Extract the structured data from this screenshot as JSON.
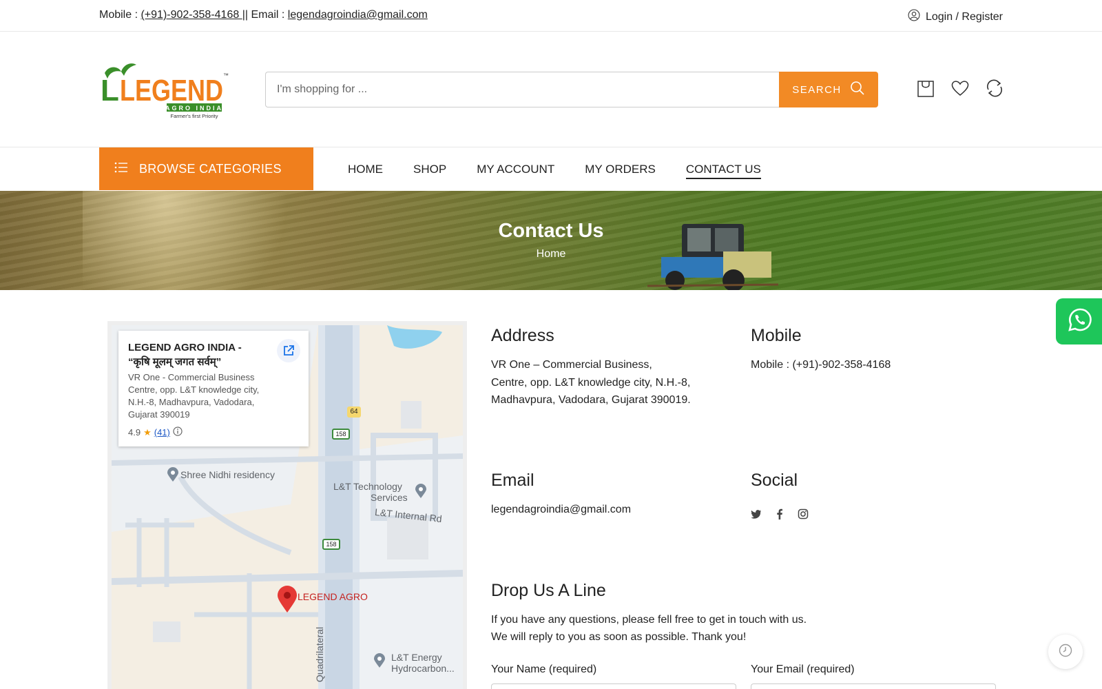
{
  "topbar": {
    "mobile_prefix": "Mobile : ",
    "mobile_link": "(+91)-902-358-4168 ",
    "separator": "|| Email : ",
    "email_link": "legendagroindia@gmail.com",
    "login": "Login / Register"
  },
  "logo": {
    "brand": "LEGEND",
    "sub": "AGRO INDIA",
    "tagline": "Farmer's first Priority",
    "tm": "™"
  },
  "search": {
    "placeholder": "I'm shopping for ...",
    "button": "SEARCH"
  },
  "header_icons": [
    "cart-icon",
    "heart-icon",
    "compare-icon"
  ],
  "nav": {
    "browse": "BROWSE CATEGORIES",
    "items": [
      {
        "label": "HOME",
        "active": false
      },
      {
        "label": "SHOP",
        "active": false
      },
      {
        "label": "MY ACCOUNT",
        "active": false
      },
      {
        "label": "MY ORDERS",
        "active": false
      },
      {
        "label": "CONTACT US",
        "active": true
      }
    ]
  },
  "banner": {
    "title": "Contact Us",
    "breadcrumb": "Home"
  },
  "map": {
    "place_name": "LEGEND AGRO INDIA - “कृषि मूलम् जगत सर्वम्”",
    "place_address": "VR One - Commercial Business Centre, opp. L&T knowledge city, N.H.-8, Madhavpura, Vadodara, Gujarat 390019",
    "rating": "4.9",
    "review_count": "(41)",
    "labels": {
      "residency": "Shree Nidhi residency",
      "lt_tech_1": "L&T Technology",
      "lt_tech_2": "Services",
      "internal_rd": "L&T Internal Rd",
      "pin": "LEGEND AGRO",
      "quadrilateral": "Quadrilateral",
      "lt_energy_1": "L&T Energy",
      "lt_energy_2": "Hydrocarbon...",
      "shield_64": "64",
      "shield_158a": "158",
      "shield_158b": "158"
    }
  },
  "address": {
    "heading": "Address",
    "line1": "VR One – Commercial Business,",
    "line2": "Centre, opp. L&T knowledge city, N.H.-8,",
    "line3": "Madhavpura, Vadodara, Gujarat 390019."
  },
  "mobile": {
    "heading": "Mobile",
    "text": "Mobile : (+91)-902-358-4168"
  },
  "email": {
    "heading": "Email",
    "text": "legendagroindia@gmail.com"
  },
  "social": {
    "heading": "Social",
    "icons": [
      "twitter-icon",
      "facebook-icon",
      "instagram-icon"
    ]
  },
  "form": {
    "heading": "Drop Us A Line",
    "intro1": "If you have any questions, please fell free to get in touch with us.",
    "intro2": "We will reply to you as soon as possible. Thank you!",
    "name_label": "Your Name (required)",
    "email_label": "Your Email (required)"
  },
  "colors": {
    "accent": "#f07f1d",
    "search_button": "#f28a25",
    "whatsapp": "#1ec65a",
    "logo_green": "#3a8f2a",
    "logo_orange": "#f07f1d"
  }
}
